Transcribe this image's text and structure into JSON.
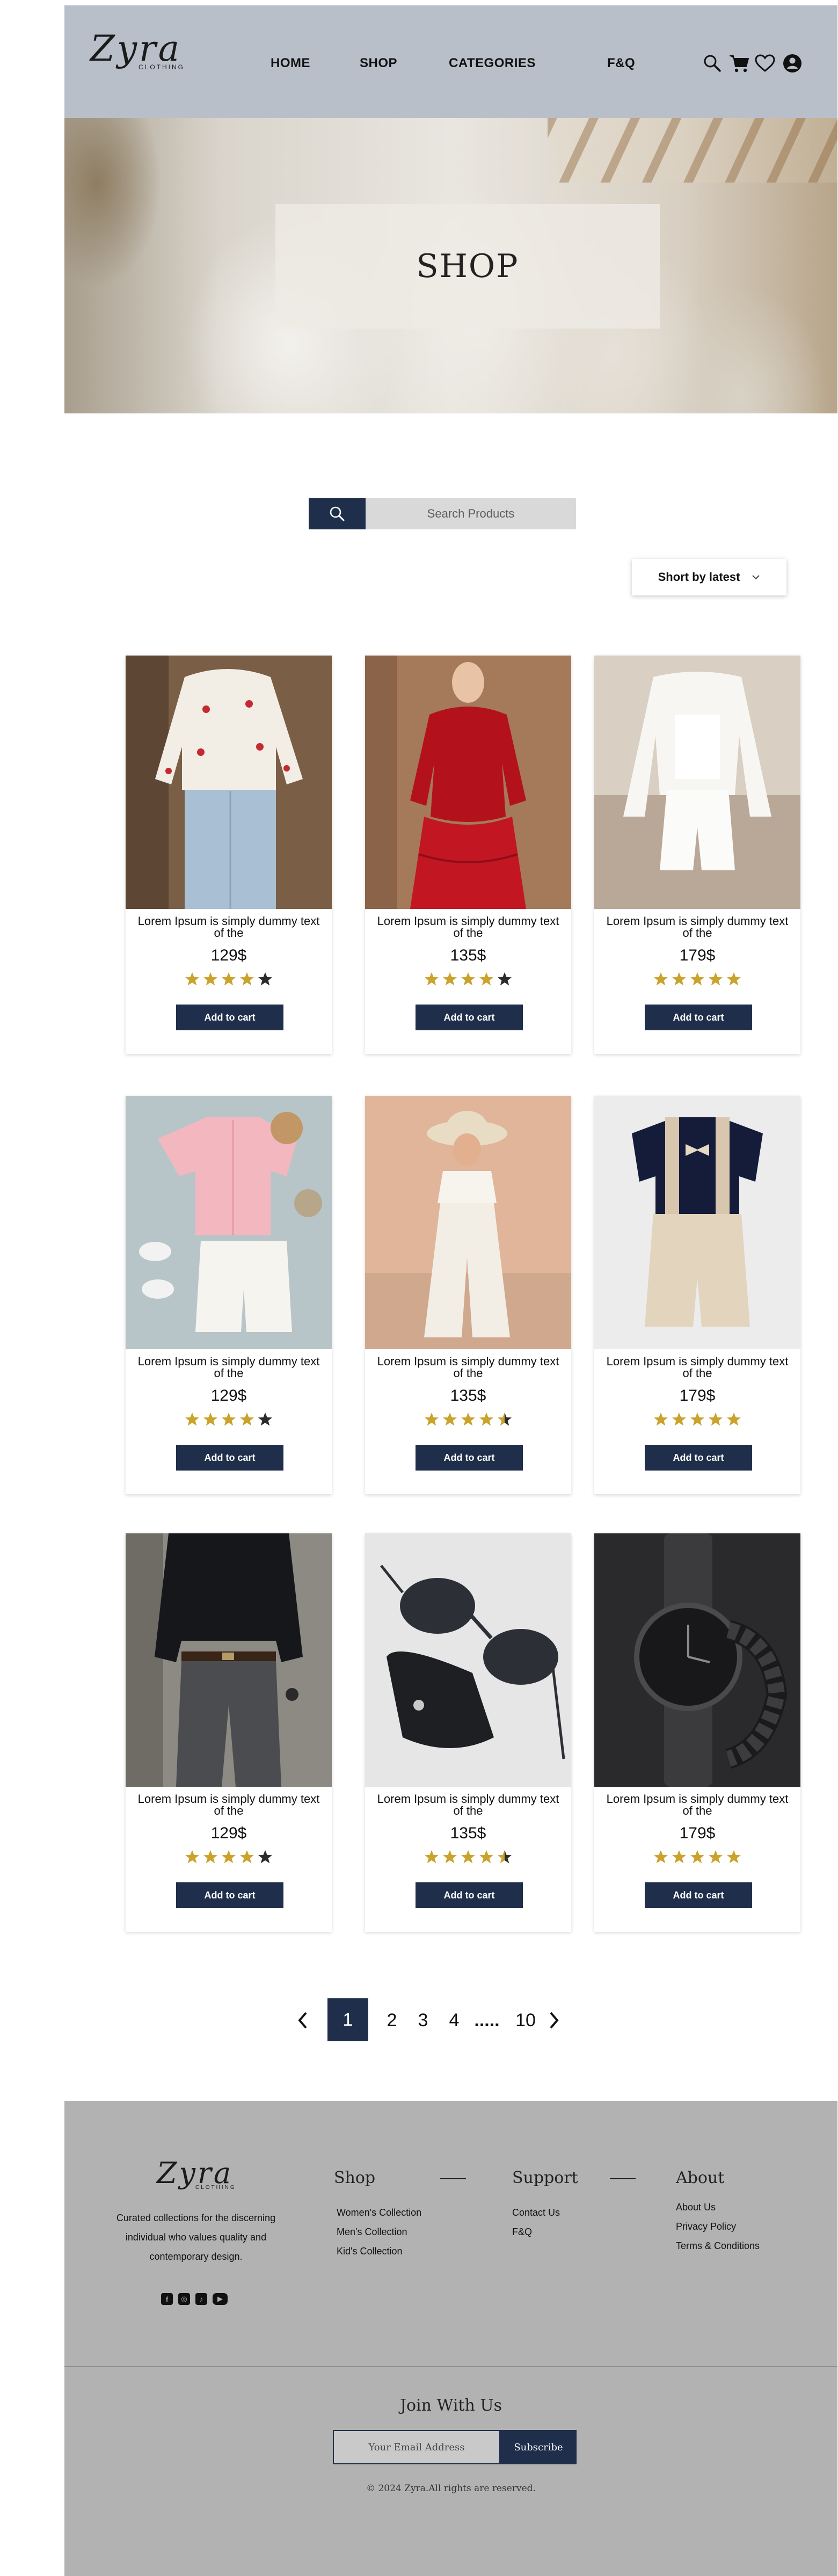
{
  "brand": {
    "logo_text": "Zyra",
    "logo_sub": "CLOTHING"
  },
  "nav": {
    "items": [
      {
        "label": "HOME"
      },
      {
        "label": "SHOP"
      },
      {
        "label": "CATEGORIES"
      },
      {
        "label": "F&Q"
      }
    ]
  },
  "header_icons": [
    "search-icon",
    "cart-icon",
    "heart-icon",
    "user-icon"
  ],
  "hero": {
    "title": "SHOP"
  },
  "search": {
    "placeholder": "Search Products"
  },
  "sort": {
    "label": "Short by latest"
  },
  "colors": {
    "accent": "#1f2e4a",
    "header_bg": "#b9bfc9",
    "footer_bg": "#b2b2b2",
    "star_gold": "#c9a32c"
  },
  "products": [
    {
      "name": "Lorem Ipsum is simply dummy text of the",
      "price": "129$",
      "rating": 4,
      "cta": "Add to cart"
    },
    {
      "name": "Lorem Ipsum is simply dummy text of the",
      "price": "135$",
      "rating": 4,
      "cta": "Add to cart"
    },
    {
      "name": "Lorem Ipsum is simply dummy text of the",
      "price": "179$",
      "rating": 5,
      "cta": "Add to cart"
    },
    {
      "name": "Lorem Ipsum is simply dummy text of the",
      "price": "129$",
      "rating": 4,
      "cta": "Add to cart"
    },
    {
      "name": "Lorem Ipsum is simply dummy text of the",
      "price": "135$",
      "rating": 4.5,
      "cta": "Add to cart"
    },
    {
      "name": "Lorem Ipsum is simply dummy text of the",
      "price": "179$",
      "rating": 5,
      "cta": "Add to cart"
    },
    {
      "name": "Lorem Ipsum is simply dummy text of the",
      "price": "129$",
      "rating": 4,
      "cta": "Add to cart"
    },
    {
      "name": "Lorem Ipsum is simply dummy text of the",
      "price": "135$",
      "rating": 4.5,
      "cta": "Add to cart"
    },
    {
      "name": "Lorem Ipsum is simply dummy text of the",
      "price": "179$",
      "rating": 5,
      "cta": "Add to cart"
    }
  ],
  "pagination": {
    "pages": [
      "1",
      "2",
      "3",
      "4",
      ".....",
      "10"
    ],
    "current": "1"
  },
  "footer": {
    "about": "Curated collections for the discerning individual who values quality and contemporary design.",
    "socials": [
      "facebook-icon",
      "instagram-icon",
      "tiktok-icon",
      "youtube-icon"
    ],
    "shop": {
      "heading": "Shop",
      "links": [
        "Women's Collection",
        "Men's Collection",
        "Kid's Collection"
      ]
    },
    "support": {
      "heading": "Support",
      "links": [
        "Contact Us",
        "F&Q"
      ]
    },
    "about_col": {
      "heading": "About",
      "links": [
        "About Us",
        "Privacy Policy",
        "Terms & Conditions"
      ]
    },
    "join": "Join With Us",
    "email_placeholder": "Your Email Address",
    "subscribe": "Subscribe",
    "copyright": "© 2024 Zyra.All rights are  reserved."
  }
}
